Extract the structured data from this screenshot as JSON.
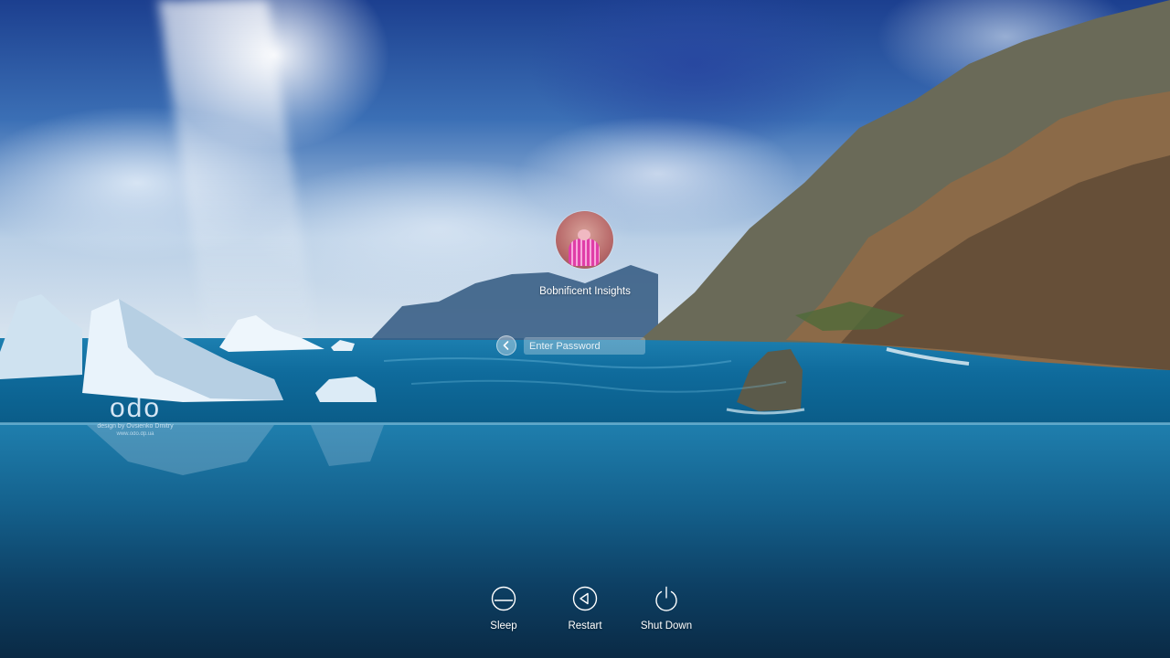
{
  "user": {
    "name": "Bobnificent Insights"
  },
  "login": {
    "password_placeholder": "Enter Password"
  },
  "power": {
    "sleep_label": "Sleep",
    "restart_label": "Restart",
    "shutdown_label": "Shut Down"
  },
  "watermark": {
    "logo": "odo",
    "credit": "design by Ovsienko Dmitry",
    "url": "www.odo.dp.ua"
  },
  "icons": {
    "back": "chevron-left-icon",
    "sleep": "sleep-icon",
    "restart": "restart-icon",
    "shutdown": "power-icon"
  }
}
